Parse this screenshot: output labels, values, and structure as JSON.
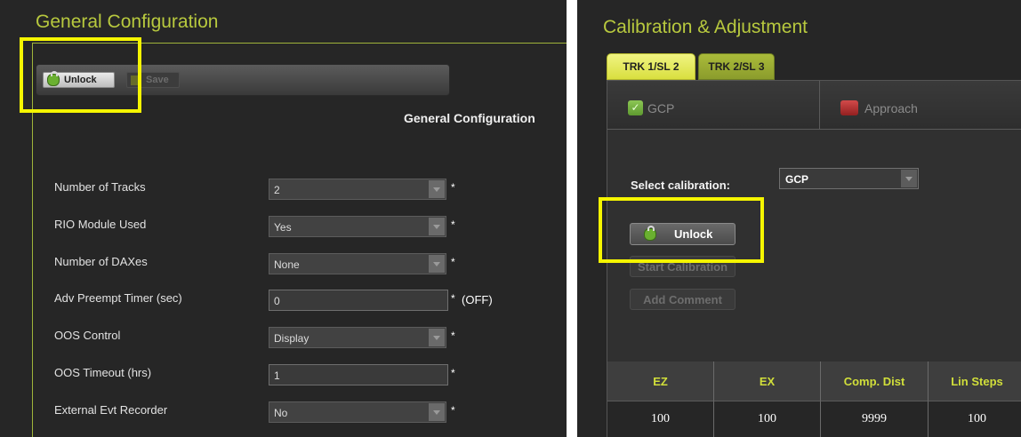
{
  "colors": {
    "accent_green": "#b8c93e",
    "highlight": "#f5f500",
    "panel_bg": "#262626"
  },
  "left": {
    "title": "General Configuration",
    "toolbar": {
      "unlock_label": "Unlock",
      "save_label": "Save"
    },
    "section_title": "General Configuration",
    "fields": [
      {
        "label": "Number of Tracks",
        "value": "2",
        "type": "select",
        "required": "*"
      },
      {
        "label": "RIO Module Used",
        "value": "Yes",
        "type": "select",
        "required": "*"
      },
      {
        "label": "Number of DAXes",
        "value": "None",
        "type": "select",
        "required": "*"
      },
      {
        "label": "Adv Preempt Timer (sec)",
        "value": "0",
        "type": "text",
        "required": "*",
        "note": "(OFF)"
      },
      {
        "label": "OOS Control",
        "value": "Display",
        "type": "select",
        "required": "*"
      },
      {
        "label": "OOS Timeout (hrs)",
        "value": "1",
        "type": "text",
        "required": "*"
      },
      {
        "label": "External Evt Recorder",
        "value": "No",
        "type": "select",
        "required": "*"
      }
    ]
  },
  "right": {
    "title": "Calibration & Adjustment",
    "tabs": [
      {
        "label": "TRK 1/SL 2",
        "active": true
      },
      {
        "label": "TRK 2/SL 3",
        "active": false
      }
    ],
    "checks": [
      {
        "label": "GCP",
        "icon": "check-icon"
      },
      {
        "label": "Approach",
        "icon": "approach-icon"
      }
    ],
    "select_calibration": {
      "label": "Select calibration:",
      "value": "GCP"
    },
    "buttons": {
      "unlock": "Unlock",
      "start": "Start Calibration",
      "comment": "Add Comment"
    },
    "table": {
      "headers": [
        "EZ",
        "EX",
        "Comp. Dist",
        "Lin Steps"
      ],
      "row": [
        "100",
        "100",
        "9999",
        "100"
      ]
    }
  }
}
